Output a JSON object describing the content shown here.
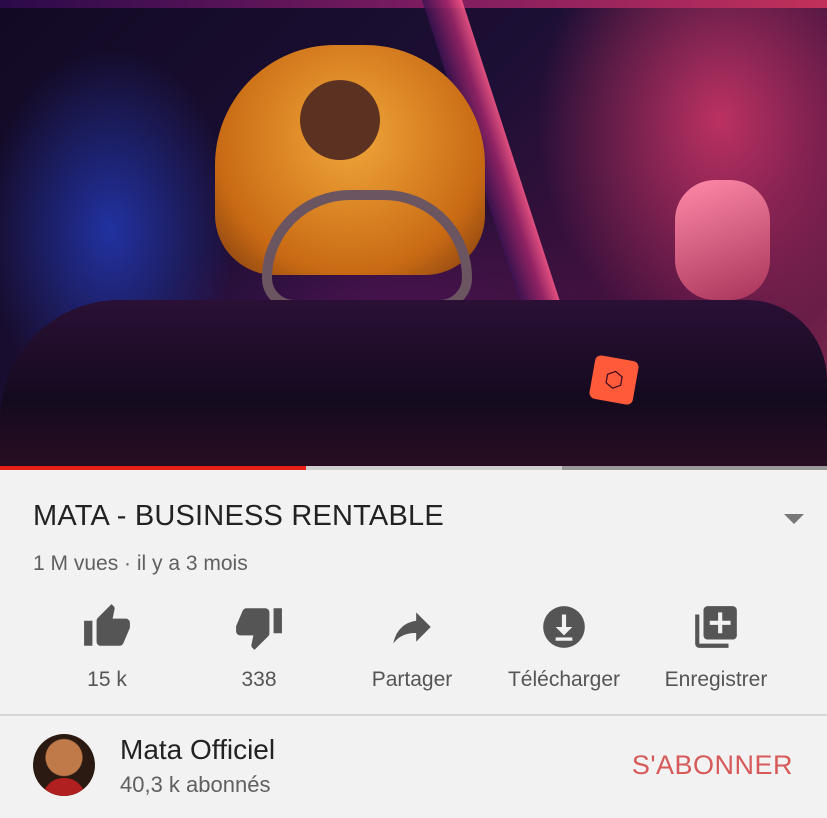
{
  "video": {
    "progress_played_fraction": 0.37,
    "progress_buffered_fraction": 0.68,
    "badge_icon": "hexagon-logo-icon"
  },
  "info": {
    "title": "MATA - BUSINESS RENTABLE",
    "meta": "1 M vues · il y a 3 mois",
    "expand_icon": "chevron-down-icon"
  },
  "actions": [
    {
      "icon": "thumbs-up-icon",
      "label": "15 k"
    },
    {
      "icon": "thumbs-down-icon",
      "label": "338"
    },
    {
      "icon": "share-icon",
      "label": "Partager"
    },
    {
      "icon": "download-icon",
      "label": "Télécharger"
    },
    {
      "icon": "playlist-add-icon",
      "label": "Enregistrer"
    }
  ],
  "channel": {
    "name": "Mata Officiel",
    "subscribers": "40,3 k abonnés",
    "subscribe_label": "S'ABONNER"
  },
  "colors": {
    "subscribe": "#d65a5a",
    "progress_played": "#e62117",
    "icon_gray": "#555555"
  }
}
